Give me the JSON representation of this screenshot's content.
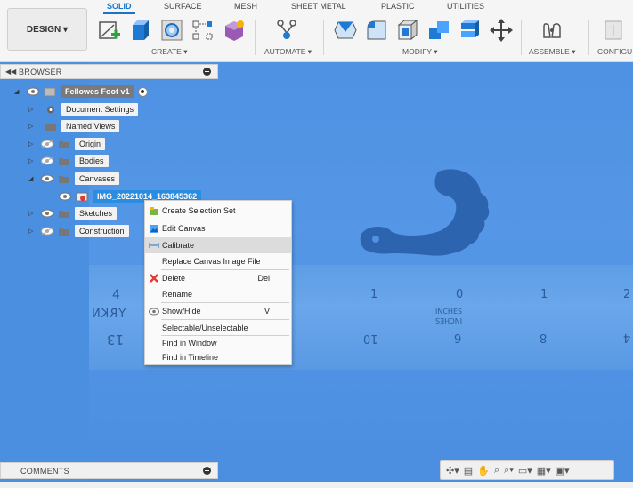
{
  "tabs": [
    "SOLID",
    "SURFACE",
    "MESH",
    "SHEET METAL",
    "PLASTIC",
    "UTILITIES"
  ],
  "design_label": "DESIGN ▾",
  "groups": {
    "create": "CREATE ▾",
    "automate": "AUTOMATE ▾",
    "modify": "MODIFY ▾",
    "assemble": "ASSEMBLE ▾",
    "configure": "CONFIGU"
  },
  "browser": {
    "title": "BROWSER",
    "root": "Fellowes Foot v1",
    "items": {
      "document_settings": "Document Settings",
      "named_views": "Named Views",
      "origin": "Origin",
      "bodies": "Bodies",
      "canvases": "Canvases",
      "canvas_image": "IMG_20221014_163845362",
      "sketches": "Sketches",
      "construction": "Construction"
    }
  },
  "context_menu": {
    "create_selection_set": "Create Selection Set",
    "edit_canvas": "Edit Canvas",
    "calibrate": "Calibrate",
    "replace_canvas_image": "Replace Canvas Image File",
    "delete": "Delete",
    "delete_shortcut": "Del",
    "rename": "Rename",
    "show_hide": "Show/Hide",
    "show_hide_shortcut": "V",
    "selectable": "Selectable/Unselectable",
    "find_in_window": "Find in Window",
    "find_in_timeline": "Find in Timeline"
  },
  "comments_label": "COMMENTS",
  "ruler_marks": {
    "n4": "4",
    "n1": "1",
    "n0": "0",
    "n1r": "1",
    "n2": "2",
    "inches": "INCHES",
    "inches_mirror": "INCHES",
    "m13": "13",
    "m10": "10",
    "m6": "6",
    "m8": "8",
    "m4": "4",
    "yrk": "YRKN"
  },
  "colors": {
    "accent": "#1a73c8",
    "canvas_blue": "#4a8fe0",
    "selection": "#2b8de0",
    "delete_red": "#e53935"
  }
}
